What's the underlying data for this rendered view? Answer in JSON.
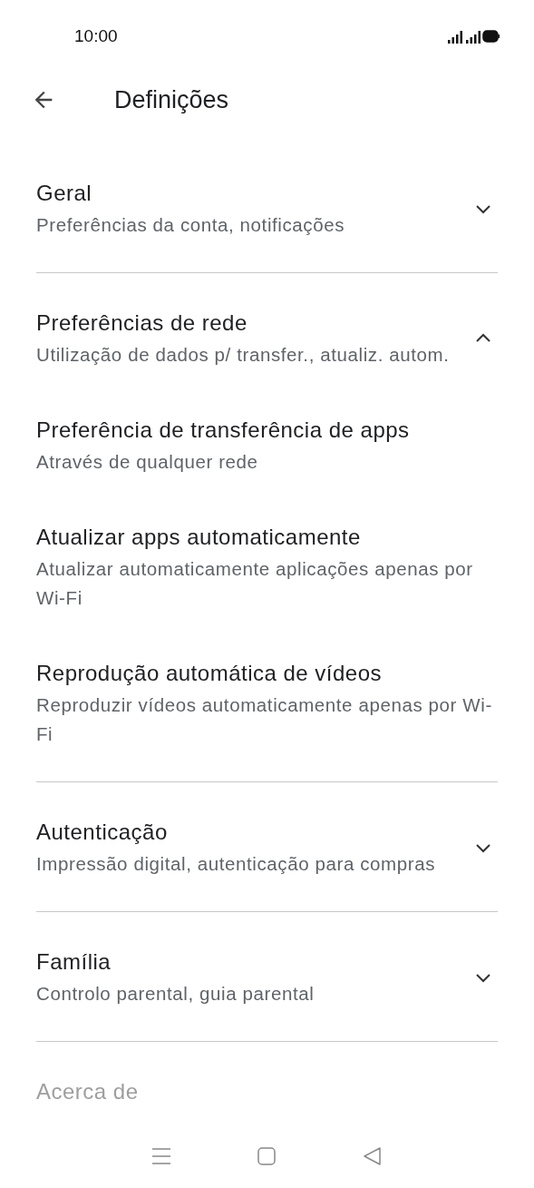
{
  "status_bar": {
    "time": "10:00"
  },
  "header": {
    "title": "Definições"
  },
  "sections": [
    {
      "title": "Geral",
      "subtitle": "Preferências da conta, notificações",
      "expanded": false
    },
    {
      "title": "Preferências de rede",
      "subtitle": "Utilização de dados p/ transfer., atualiz. autom.",
      "expanded": true,
      "children": [
        {
          "title": "Preferência de transferência de apps",
          "subtitle": "Através de qualquer rede"
        },
        {
          "title": "Atualizar apps automaticamente",
          "subtitle": "Atualizar automaticamente aplicações apenas por Wi-Fi"
        },
        {
          "title": "Reprodução automática de vídeos",
          "subtitle": "Reproduzir vídeos automaticamente apenas por Wi-Fi"
        }
      ]
    },
    {
      "title": "Autenticação",
      "subtitle": "Impressão digital, autenticação para compras",
      "expanded": false
    },
    {
      "title": "Família",
      "subtitle": "Controlo parental, guia parental",
      "expanded": false
    },
    {
      "title": "Acerca de"
    }
  ]
}
